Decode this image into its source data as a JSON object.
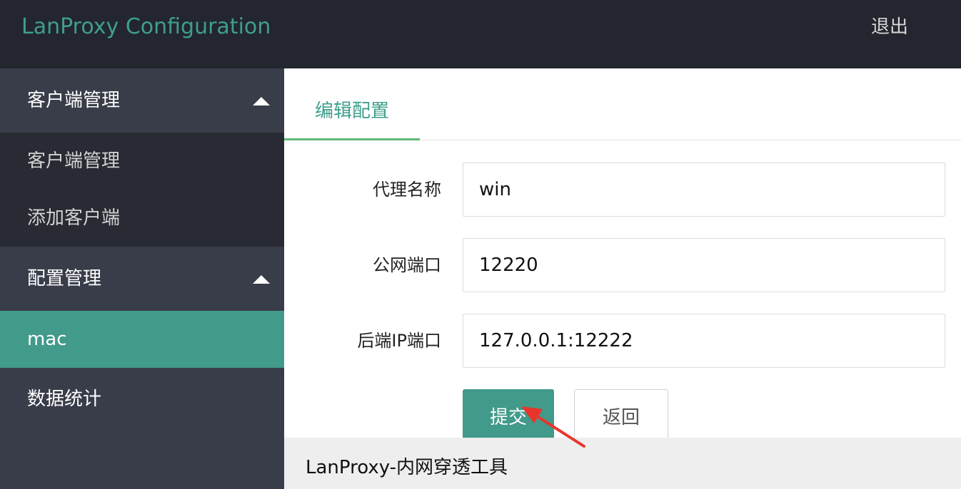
{
  "header": {
    "brand": "LanProxy Configuration",
    "logout_label": "退出"
  },
  "sidebar": {
    "groups": [
      {
        "label": "客户端管理",
        "expanded": true,
        "items": [
          {
            "label": "客户端管理"
          },
          {
            "label": "添加客户端"
          }
        ]
      },
      {
        "label": "配置管理",
        "expanded": true,
        "items": [
          {
            "label": "mac",
            "active": true
          }
        ]
      }
    ],
    "single_items": [
      {
        "label": "数据统计"
      }
    ]
  },
  "main": {
    "tab_label": "编辑配置",
    "form": {
      "fields": [
        {
          "label": "代理名称",
          "value": "win"
        },
        {
          "label": "公网端口",
          "value": "12220"
        },
        {
          "label": "后端IP端口",
          "value": "127.0.0.1:12222"
        }
      ],
      "submit_label": "提交",
      "back_label": "返回"
    }
  },
  "footer": {
    "text": "LanProxy-内网穿透工具"
  },
  "colors": {
    "header_bg": "#23262e",
    "brand": "#3f9e8c",
    "sidebar_bg": "#393d49",
    "sidebar_child_bg": "#282b33",
    "active": "#429a8a",
    "tab_underline": "#5fb878",
    "annotation_arrow": "#e8352b"
  },
  "icons": {
    "group_toggle": "caret-up-icon",
    "annotation": "red-arrow-icon"
  }
}
